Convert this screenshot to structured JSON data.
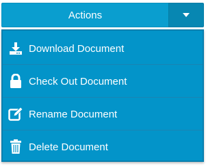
{
  "actions_button": {
    "label": "Actions",
    "toggle_icon": "caret-down-icon"
  },
  "menu": {
    "items": [
      {
        "label": "Download Document",
        "icon": "download-icon"
      },
      {
        "label": "Check Out Document",
        "icon": "lock-icon"
      },
      {
        "label": "Rename Document",
        "icon": "edit-icon"
      },
      {
        "label": "Delete Document",
        "icon": "trash-icon"
      }
    ]
  },
  "colors": {
    "button_bg": "#0a9ecf",
    "toggle_bg": "#0787b2",
    "menu_bg": "#0394c9",
    "text": "#ffffff"
  }
}
